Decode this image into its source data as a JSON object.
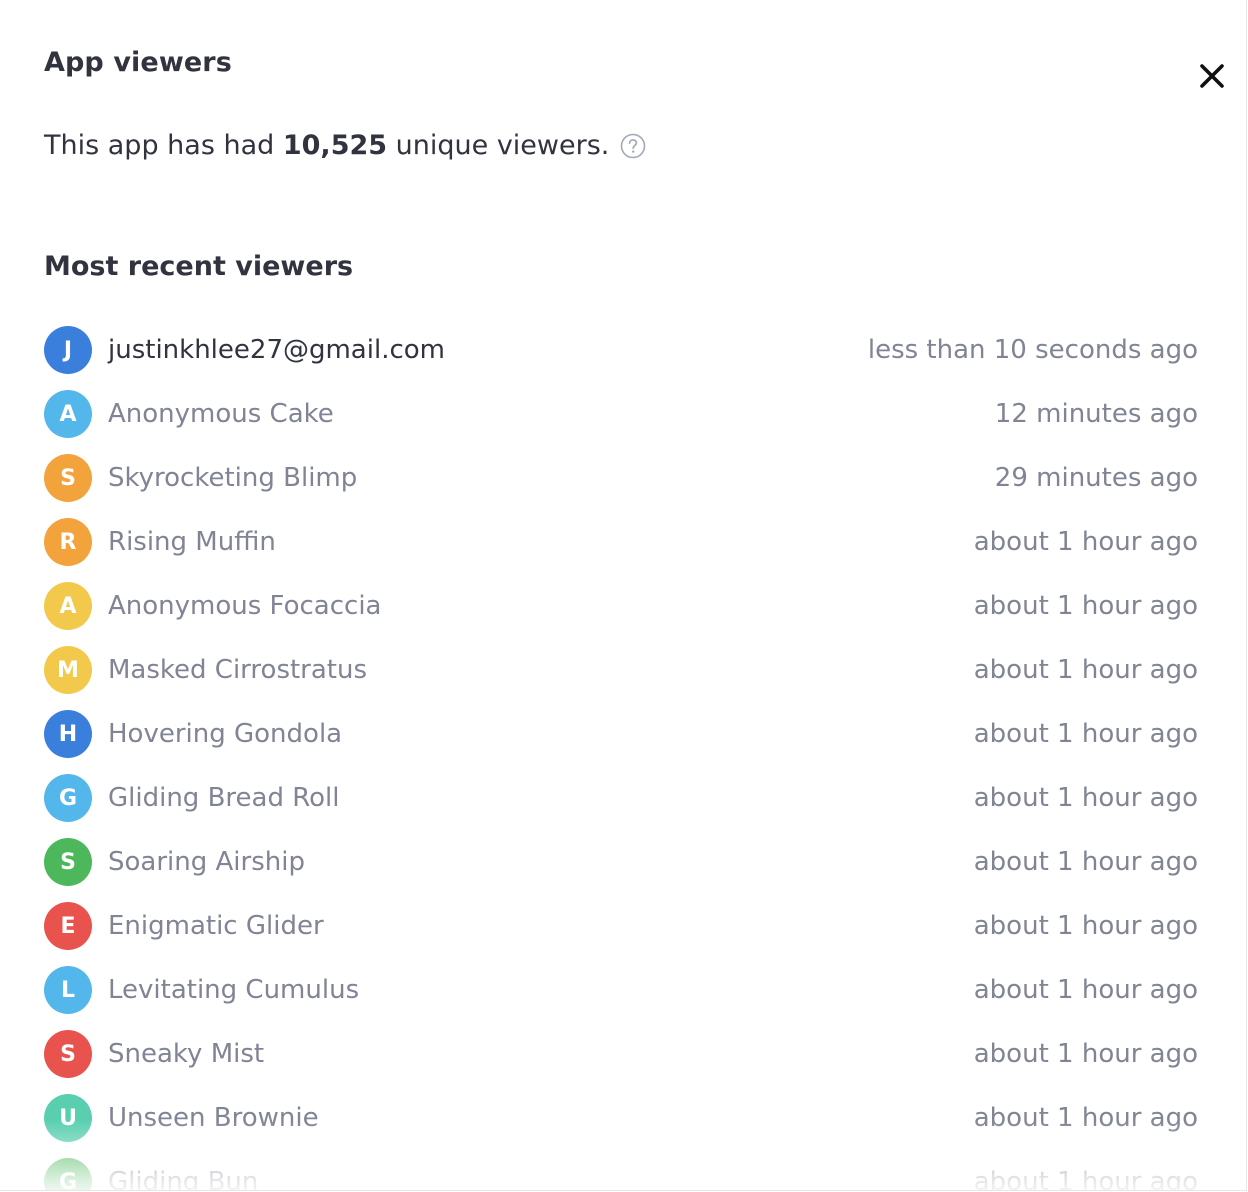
{
  "modal": {
    "title": "App viewers",
    "close_icon": "close-icon"
  },
  "summary": {
    "prefix": "This app has had ",
    "count": "10,525",
    "suffix": " unique viewers.",
    "help_icon": "question-circle-icon"
  },
  "recent": {
    "title": "Most recent viewers",
    "viewers": [
      {
        "initial": "J",
        "name": "justinkhlee27@gmail.com",
        "time": "less than 10 seconds ago",
        "color": "#3b7fdc",
        "primary": true
      },
      {
        "initial": "A",
        "name": "Anonymous Cake",
        "time": "12 minutes ago",
        "color": "#53b7ec"
      },
      {
        "initial": "S",
        "name": "Skyrocketing Blimp",
        "time": "29 minutes ago",
        "color": "#f2a33c"
      },
      {
        "initial": "R",
        "name": "Rising Muffin",
        "time": "about 1 hour ago",
        "color": "#f2a33c"
      },
      {
        "initial": "A",
        "name": "Anonymous Focaccia",
        "time": "about 1 hour ago",
        "color": "#f3c94b"
      },
      {
        "initial": "M",
        "name": "Masked Cirrostratus",
        "time": "about 1 hour ago",
        "color": "#f3c94b"
      },
      {
        "initial": "H",
        "name": "Hovering Gondola",
        "time": "about 1 hour ago",
        "color": "#3b7fdc"
      },
      {
        "initial": "G",
        "name": "Gliding Bread Roll",
        "time": "about 1 hour ago",
        "color": "#53b7ec"
      },
      {
        "initial": "S",
        "name": "Soaring Airship",
        "time": "about 1 hour ago",
        "color": "#4cb85b"
      },
      {
        "initial": "E",
        "name": "Enigmatic Glider",
        "time": "about 1 hour ago",
        "color": "#e8534e"
      },
      {
        "initial": "L",
        "name": "Levitating Cumulus",
        "time": "about 1 hour ago",
        "color": "#53b7ec"
      },
      {
        "initial": "S",
        "name": "Sneaky Mist",
        "time": "about 1 hour ago",
        "color": "#e8534e"
      },
      {
        "initial": "U",
        "name": "Unseen Brownie",
        "time": "about 1 hour ago",
        "color": "#5acfb0"
      },
      {
        "initial": "G",
        "name": "Gliding Bun",
        "time": "about 1 hour ago",
        "color": "#4cb85b"
      }
    ]
  }
}
